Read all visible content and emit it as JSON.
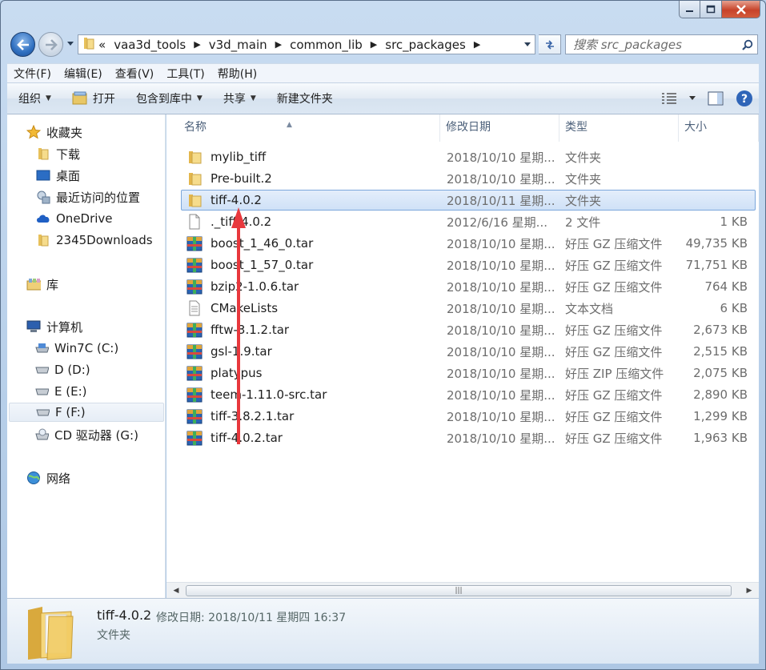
{
  "address": {
    "overflow": "«",
    "crumbs": [
      "vaa3d_tools",
      "v3d_main",
      "common_lib",
      "src_packages"
    ]
  },
  "search": {
    "placeholder": "搜索 src_packages"
  },
  "menu": [
    "文件(F)",
    "编辑(E)",
    "查看(V)",
    "工具(T)",
    "帮助(H)"
  ],
  "toolbar": {
    "organize": "组织",
    "open": "打开",
    "include_library": "包含到库中",
    "share": "共享",
    "new_folder": "新建文件夹"
  },
  "sidebar": {
    "favorites": {
      "label": "收藏夹",
      "items": [
        "下载",
        "桌面",
        "最近访问的位置",
        "OneDrive",
        "2345Downloads"
      ]
    },
    "library": "库",
    "computer": {
      "label": "计算机",
      "items": [
        "Win7C (C:)",
        "D (D:)",
        "E (E:)",
        "F (F:)",
        "CD 驱动器 (G:)"
      ]
    },
    "network": "网络"
  },
  "columns": [
    "名称",
    "修改日期",
    "类型",
    "大小"
  ],
  "files": [
    {
      "name": "mylib_tiff",
      "date": "2018/10/10 星期...",
      "type": "文件夹",
      "size": "",
      "icon": "folder-icon"
    },
    {
      "name": "Pre-built.2",
      "date": "2018/10/10 星期...",
      "type": "文件夹",
      "size": "",
      "icon": "folder-icon"
    },
    {
      "name": "tiff-4.0.2",
      "date": "2018/10/11 星期...",
      "type": "文件夹",
      "size": "",
      "icon": "folder-icon"
    },
    {
      "name": "._tiff-4.0.2",
      "date": "2012/6/16 星期...",
      "type": "2 文件",
      "size": "1 KB",
      "icon": "blank-file-icon"
    },
    {
      "name": "boost_1_46_0.tar",
      "date": "2018/10/10 星期...",
      "type": "好压 GZ 压缩文件",
      "size": "49,735 KB",
      "icon": "archive-icon"
    },
    {
      "name": "boost_1_57_0.tar",
      "date": "2018/10/10 星期...",
      "type": "好压 GZ 压缩文件",
      "size": "71,751 KB",
      "icon": "archive-icon"
    },
    {
      "name": "bzip2-1.0.6.tar",
      "date": "2018/10/10 星期...",
      "type": "好压 GZ 压缩文件",
      "size": "764 KB",
      "icon": "archive-icon"
    },
    {
      "name": "CMakeLists",
      "date": "2018/10/10 星期...",
      "type": "文本文档",
      "size": "6 KB",
      "icon": "text-file-icon"
    },
    {
      "name": "fftw-3.1.2.tar",
      "date": "2018/10/10 星期...",
      "type": "好压 GZ 压缩文件",
      "size": "2,673 KB",
      "icon": "archive-icon"
    },
    {
      "name": "gsl-1.9.tar",
      "date": "2018/10/10 星期...",
      "type": "好压 GZ 压缩文件",
      "size": "2,515 KB",
      "icon": "archive-icon"
    },
    {
      "name": "platypus",
      "date": "2018/10/10 星期...",
      "type": "好压 ZIP 压缩文件",
      "size": "2,075 KB",
      "icon": "archive-icon"
    },
    {
      "name": "teem-1.11.0-src.tar",
      "date": "2018/10/10 星期...",
      "type": "好压 GZ 压缩文件",
      "size": "2,890 KB",
      "icon": "archive-icon"
    },
    {
      "name": "tiff-3.8.2.1.tar",
      "date": "2018/10/10 星期...",
      "type": "好压 GZ 压缩文件",
      "size": "1,299 KB",
      "icon": "archive-icon"
    },
    {
      "name": "tiff-4.0.2.tar",
      "date": "2018/10/10 星期...",
      "type": "好压 GZ 压缩文件",
      "size": "1,963 KB",
      "icon": "archive-icon"
    }
  ],
  "selected_index": 2,
  "details": {
    "name": "tiff-4.0.2",
    "modified": "修改日期: 2018/10/11 星期四 16:37",
    "kind": "文件夹"
  },
  "colors": {
    "selection": "#cfe1f7",
    "annotation_arrow": "#e8383d"
  }
}
